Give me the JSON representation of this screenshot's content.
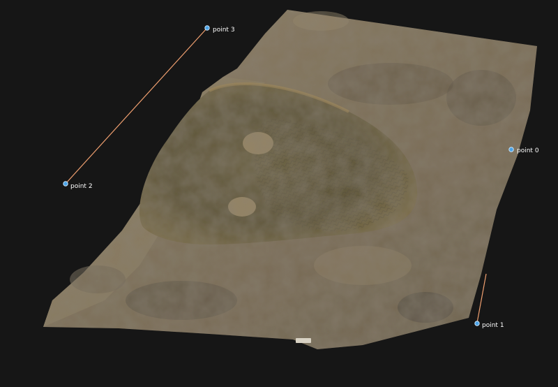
{
  "viewer": {
    "background": "#161616",
    "measure_line_color": "#f0a070",
    "marker_color": "#4aa3e8"
  },
  "points": [
    {
      "label": "point 0"
    },
    {
      "label": "point 1"
    },
    {
      "label": "point 2"
    },
    {
      "label": "point 3"
    }
  ],
  "specimen": {
    "tag_text": "",
    "description_colors": {
      "slab": "#8a7a62",
      "fossil": "#6e6238",
      "edge": "#a89272"
    }
  }
}
